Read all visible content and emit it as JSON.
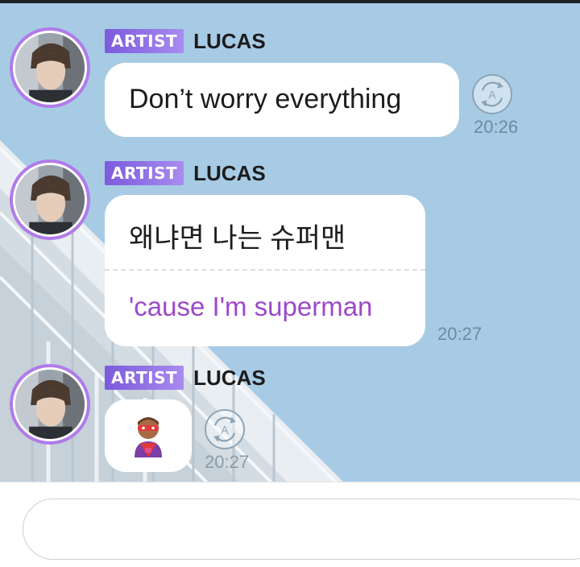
{
  "messages": [
    {
      "badge": "ARTIST",
      "sender": "LUCAS",
      "text": "Don’t worry everything",
      "time": "20:26",
      "has_translate_button": true
    },
    {
      "badge": "ARTIST",
      "sender": "LUCAS",
      "text": "왜냐면 나는 슈퍼맨",
      "translation": "'cause I'm superman",
      "time": "20:27",
      "has_translate_button": false
    },
    {
      "badge": "ARTIST",
      "sender": "LUCAS",
      "emoji": "🦸",
      "emoji_icon": "superhero-icon",
      "time": "20:27",
      "has_translate_button": true
    }
  ],
  "translate_icon_letter": "A",
  "input": {
    "placeholder": "",
    "value": ""
  },
  "colors": {
    "chat_background": "#a7cbe4",
    "badge_start": "#7b5bdc",
    "badge_end": "#a98bf0",
    "avatar_ring": "#b07bea",
    "translation_text": "#9b49c9",
    "timestamp": "#6e8aa0"
  }
}
